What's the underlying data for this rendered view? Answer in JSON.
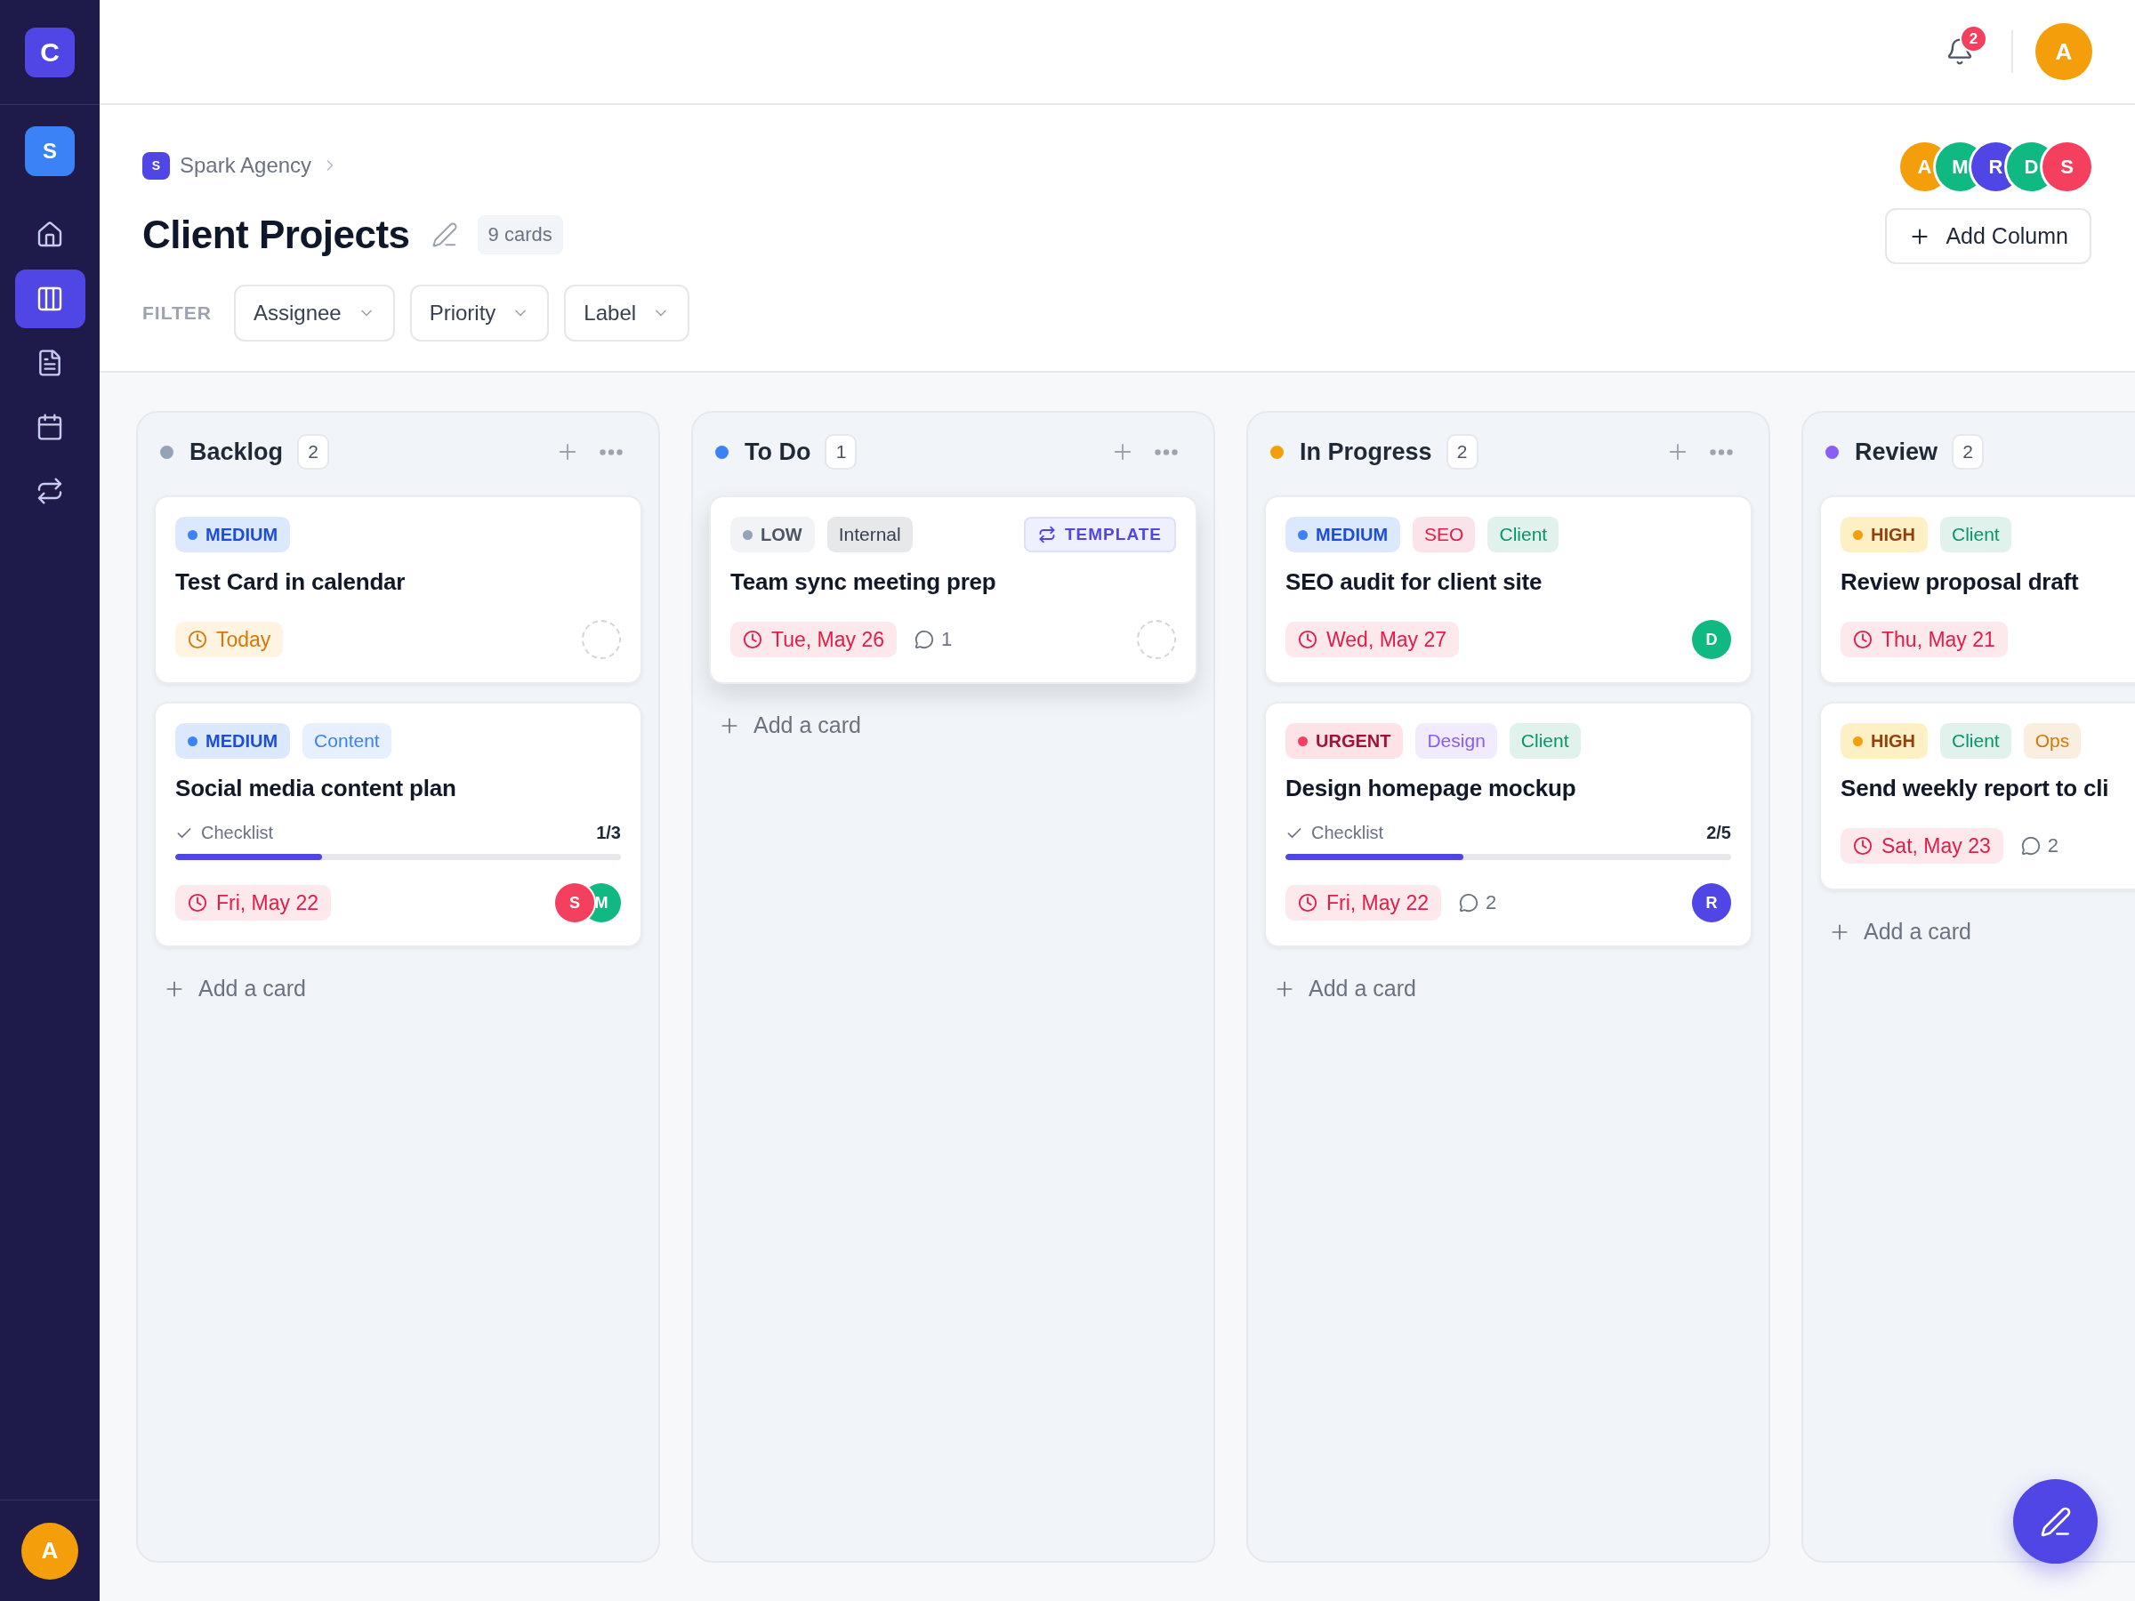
{
  "sidebar": {
    "logo": "C",
    "workspace": "S",
    "items": [
      {
        "selected": false
      },
      {
        "selected": true
      },
      {
        "selected": false
      },
      {
        "selected": false
      },
      {
        "selected": false
      }
    ],
    "user": "A"
  },
  "top_bar": {
    "notifications": "2",
    "user": "A"
  },
  "header": {
    "breadcrumb": {
      "initial": "S",
      "label": "Spark Agency"
    },
    "title": "Client Projects",
    "card_count": "9 cards",
    "filter": {
      "label": "FILTER",
      "options": [
        "Assignee",
        "Priority",
        "Label"
      ]
    },
    "members": [
      {
        "initial": "A",
        "color": "#f59e0b"
      },
      {
        "initial": "M",
        "color": "#10b981"
      },
      {
        "initial": "R",
        "color": "#4f46e5"
      },
      {
        "initial": "D",
        "color": "#10b981"
      },
      {
        "initial": "S",
        "color": "#f43f5e"
      }
    ],
    "add_column": "Add Column"
  },
  "columns": [
    {
      "title": "Backlog",
      "count": "2",
      "color": "#94a3b8",
      "actions": true,
      "cards": [
        {
          "priority": {
            "label": "MEDIUM",
            "kind": "medium"
          },
          "title": "Test Card in calendar",
          "due": {
            "label": "Today",
            "kind": "today"
          },
          "unassigned": true,
          "raised": false
        },
        {
          "priority": {
            "label": "MEDIUM",
            "kind": "medium"
          },
          "tags": [
            {
              "label": "Content",
              "color": "#3b82f6"
            }
          ],
          "title": "Social media content plan",
          "checklist": {
            "label": "Checklist",
            "count": "1/3",
            "level": 0.33
          },
          "due": {
            "label": "Fri, May 22",
            "kind": "due"
          },
          "assignees": [
            {
              "initial": "S",
              "color": "#f43f5e"
            },
            {
              "initial": "M",
              "color": "#10b981"
            }
          ],
          "unassigned": false,
          "raised": false
        }
      ],
      "add_card": "Add a card"
    },
    {
      "title": "To Do",
      "count": "1",
      "color": "#3b82f6",
      "actions": true,
      "cards": [
        {
          "priority": {
            "label": "LOW",
            "kind": "low"
          },
          "tags": [
            {
              "label": "Internal",
              "color": "#374151"
            }
          ],
          "template": "TEMPLATE",
          "title": "Team sync meeting prep",
          "due": {
            "label": "Tue, May 26",
            "kind": "due"
          },
          "comments": "1",
          "unassigned": true,
          "raised": true
        }
      ],
      "add_card": "Add a card"
    },
    {
      "title": "In Progress",
      "count": "2",
      "color": "#f59e0b",
      "actions": true,
      "cards": [
        {
          "priority": {
            "label": "MEDIUM",
            "kind": "medium"
          },
          "tags": [
            {
              "label": "SEO",
              "color": "#e11d48"
            },
            {
              "label": "Client",
              "color": "#059669"
            }
          ],
          "title": "SEO audit for client site",
          "due": {
            "label": "Wed, May 27",
            "kind": "due"
          },
          "assignees": [
            {
              "initial": "D",
              "color": "#10b981"
            }
          ],
          "unassigned": false,
          "raised": false
        },
        {
          "priority": {
            "label": "URGENT",
            "kind": "urgent"
          },
          "tags": [
            {
              "label": "Design",
              "color": "#8b5cf6"
            },
            {
              "label": "Client",
              "color": "#059669"
            }
          ],
          "title": "Design homepage mockup",
          "checklist": {
            "label": "Checklist",
            "count": "2/5",
            "level": 0.4
          },
          "due": {
            "label": "Fri, May 22",
            "kind": "due"
          },
          "comments": "2",
          "assignees": [
            {
              "initial": "R",
              "color": "#4f46e5"
            }
          ],
          "unassigned": false,
          "raised": false
        }
      ],
      "add_card": "Add a card"
    },
    {
      "title": "Review",
      "count": "2",
      "color": "#8b5cf6",
      "actions": false,
      "cards": [
        {
          "priority": {
            "label": "HIGH",
            "kind": "high"
          },
          "tags": [
            {
              "label": "Client",
              "color": "#059669"
            }
          ],
          "title": "Review proposal draft",
          "due": {
            "label": "Thu, May 21",
            "kind": "due"
          },
          "unassigned": false,
          "raised": false
        },
        {
          "priority": {
            "label": "HIGH",
            "kind": "high"
          },
          "tags": [
            {
              "label": "Client",
              "color": "#059669"
            },
            {
              "label": "Ops",
              "color": "#d97706"
            }
          ],
          "title": "Send weekly report to cli",
          "due": {
            "label": "Sat, May 23",
            "kind": "due"
          },
          "comments": "2",
          "unassigned": false,
          "raised": false
        }
      ],
      "add_card": "Add a card"
    }
  ]
}
